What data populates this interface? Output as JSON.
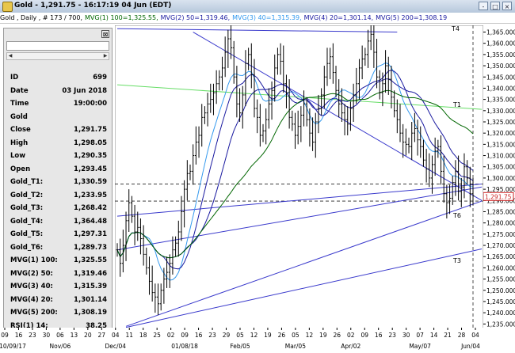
{
  "window": {
    "title": "Gold - 1,291.75 - 16:17:19  04 Jun (EDT)",
    "buttons": [
      "-",
      "□",
      "×"
    ]
  },
  "infobar": {
    "symbol": "Gold , Daily , # 173 / 700,",
    "mvg1": "MVG(1) 100=1,325.55,",
    "mvg2": "MVG(2) 50=1,319.46,",
    "mvg3": "MVG(3) 40=1,315.39,",
    "mvg4": "MVG(4) 20=1,301.14,",
    "mvg5": "MVG(5) 200=1,308.19"
  },
  "panel": {
    "close": "⊠",
    "rows": [
      {
        "k": "ID",
        "v": "699"
      },
      {
        "k": "Date",
        "v": "03 Jun 2018"
      },
      {
        "k": "Time",
        "v": "19:00:00"
      },
      {
        "k": "Gold",
        "v": ""
      },
      {
        "k": "Close",
        "v": "1,291.75"
      },
      {
        "k": "High",
        "v": "1,298.05"
      },
      {
        "k": "Low",
        "v": "1,290.35"
      },
      {
        "k": "Open",
        "v": "1,293.45"
      },
      {
        "k": "Gold_T1:",
        "v": "1,330.59"
      },
      {
        "k": "Gold_T2:",
        "v": "1,233.95"
      },
      {
        "k": "Gold_T3:",
        "v": "1,268.42"
      },
      {
        "k": "Gold_T4:",
        "v": "1,364.48"
      },
      {
        "k": "Gold_T5:",
        "v": "1,297.31"
      },
      {
        "k": "Gold_T6:",
        "v": "1,289.73"
      },
      {
        "k": "MVG(1) 100:",
        "v": "1,325.55"
      },
      {
        "k": "MVG(2) 50:",
        "v": "1,319.46"
      },
      {
        "k": "MVG(3) 40:",
        "v": "1,315.39"
      },
      {
        "k": "MVG(4) 20:",
        "v": "1,301.14"
      },
      {
        "k": "MVG(5) 200:",
        "v": "1,308.19"
      },
      {
        "k": "RSI(1) 14:",
        "v": "38.25"
      }
    ]
  },
  "chart_data": {
    "type": "line",
    "title": "Gold , Daily",
    "ylim": [
      1233,
      1368
    ],
    "y_ticks": [
      1235,
      1240,
      1245,
      1250,
      1255,
      1260,
      1265,
      1270,
      1275,
      1280,
      1285,
      1290,
      1295,
      1300,
      1305,
      1310,
      1315,
      1320,
      1325,
      1330,
      1335,
      1340,
      1345,
      1350,
      1355,
      1360,
      1365
    ],
    "last_price": "1,291.75",
    "x_day_labels": [
      "09",
      "16",
      "23",
      "30",
      "06",
      "13",
      "20",
      "27",
      "04",
      "11",
      "18",
      "25",
      "02",
      "09",
      "16",
      "23",
      "29",
      "05",
      "12",
      "19",
      "26",
      "05",
      "12",
      "19",
      "26",
      "02",
      "09",
      "16",
      "23",
      "30",
      "07",
      "14",
      "21",
      "28",
      "04"
    ],
    "x_month_labels": [
      "10/09/17",
      "Nov/06",
      "Dec/04",
      "01/08/18",
      "Feb/05",
      "Mar/05",
      "Apr/02",
      "May/07",
      "Jun/04"
    ],
    "trendline_labels": [
      "T4",
      "T1",
      "T6",
      "T3"
    ],
    "colors": {
      "t1": "#66dd66",
      "t4": "#3a3acc",
      "ma100": "#006600",
      "ma50": "#1a1aa0",
      "ma40": "#3399ee",
      "ma20": "#1a1aa0",
      "ma200": "#1a1aa0",
      "price_box": "#cc2222"
    },
    "ohlc_close": [
      1268,
      1262,
      1270,
      1281,
      1289,
      1283,
      1276,
      1278,
      1273,
      1266,
      1260,
      1254,
      1249,
      1247,
      1244,
      1250,
      1255,
      1258,
      1262,
      1268,
      1271,
      1276,
      1285,
      1295,
      1302,
      1303,
      1310,
      1316,
      1319,
      1327,
      1329,
      1333,
      1335,
      1338,
      1342,
      1345,
      1349,
      1356,
      1362,
      1358,
      1345,
      1333,
      1329,
      1337,
      1351,
      1355,
      1346,
      1331,
      1327,
      1319,
      1321,
      1326,
      1333,
      1339,
      1349,
      1355,
      1352,
      1342,
      1338,
      1327,
      1324,
      1319,
      1323,
      1328,
      1333,
      1326,
      1320,
      1316,
      1325,
      1331,
      1337,
      1345,
      1351,
      1354,
      1347,
      1339,
      1333,
      1329,
      1326,
      1324,
      1331,
      1337,
      1342,
      1349,
      1353,
      1355,
      1361,
      1364,
      1356,
      1345,
      1338,
      1342,
      1350,
      1344,
      1336,
      1330,
      1326,
      1320,
      1316,
      1315,
      1314,
      1320,
      1322,
      1317,
      1314,
      1308,
      1304,
      1300,
      1306,
      1312,
      1314,
      1303,
      1293,
      1289,
      1291,
      1298,
      1303,
      1294,
      1296,
      1305,
      1300,
      1293,
      1292
    ]
  }
}
